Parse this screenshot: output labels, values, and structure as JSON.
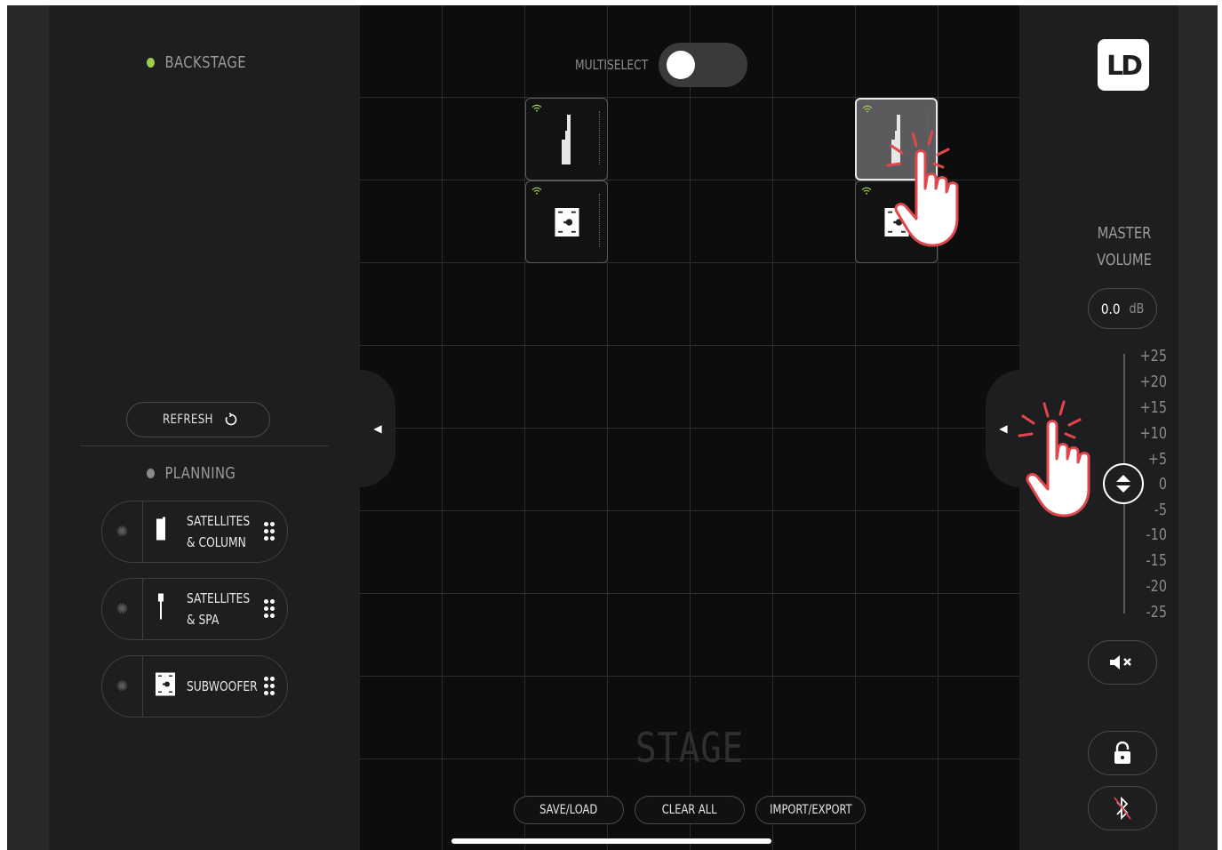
{
  "left_panel": {
    "backstage_label": "BACKSTAGE",
    "refresh_label": "REFRESH",
    "planning_label": "PLANNING",
    "presets": [
      {
        "line1": "SATELLITES",
        "line2": "& COLUMN",
        "icon": "column-speaker-icon"
      },
      {
        "line1": "SATELLITES",
        "line2": "& SPA",
        "icon": "satellite-stand-icon"
      },
      {
        "line1": "SUBWOOFER",
        "line2": "",
        "icon": "subwoofer-icon"
      }
    ]
  },
  "stage": {
    "multiselect_label": "MULTISELECT",
    "multiselect_on": false,
    "title": "STAGE",
    "buttons": {
      "save_load": "SAVE/LOAD",
      "clear_all": "CLEAR ALL",
      "import_export": "IMPORT/EXPORT"
    },
    "devices": [
      {
        "type": "column",
        "selected": false,
        "wifi": true
      },
      {
        "type": "column",
        "selected": true,
        "wifi": true
      },
      {
        "type": "subwoofer",
        "selected": false,
        "wifi": true
      },
      {
        "type": "subwoofer",
        "selected": false,
        "wifi": true
      }
    ]
  },
  "right_panel": {
    "logo_text": "LD",
    "master_volume_line1": "MASTER",
    "master_volume_line2": "VOLUME",
    "volume_value": "0.0",
    "volume_unit": "dB",
    "scale_ticks": [
      "+25",
      "+20",
      "+15",
      "+10",
      "+5",
      "0",
      "-5",
      "-10",
      "-15",
      "-20",
      "-25"
    ],
    "mute_icon": "speaker-mute-icon",
    "lock_icon": "unlock-icon",
    "bluetooth_icon": "bluetooth-off-icon"
  },
  "colors": {
    "accent_green": "#9ccc4b",
    "hand_red": "#e0474c"
  }
}
